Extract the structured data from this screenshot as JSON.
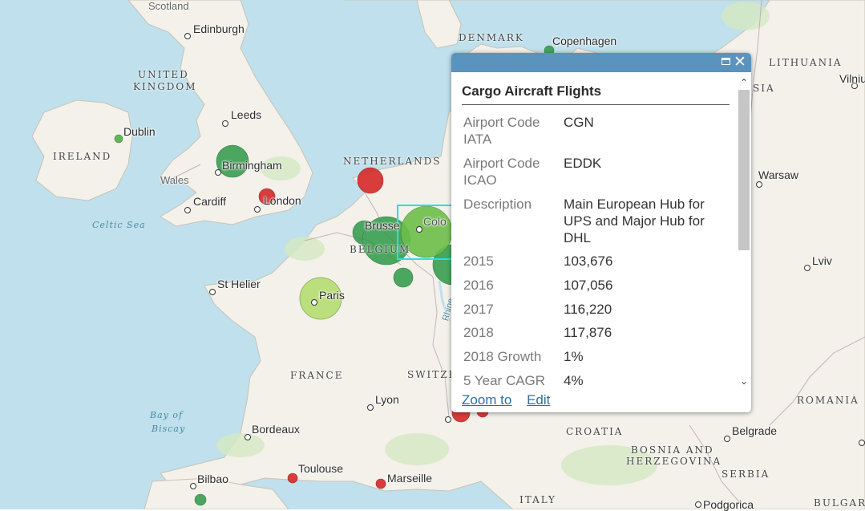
{
  "map": {
    "country_labels": [
      {
        "name": "denmark",
        "text": "DENMARK"
      },
      {
        "name": "united-kingdom-1",
        "text": "UNITED"
      },
      {
        "name": "united-kingdom-2",
        "text": "KINGDOM"
      },
      {
        "name": "ireland",
        "text": "IRELAND"
      },
      {
        "name": "netherlands",
        "text": "NETHERLANDS"
      },
      {
        "name": "belgium",
        "text": "BELGIUM"
      },
      {
        "name": "france",
        "text": "FRANCE"
      },
      {
        "name": "switzerland",
        "text": "SWITZE"
      },
      {
        "name": "lithuania",
        "text": "LITHUANIA"
      },
      {
        "name": "croatia",
        "text": "CROATIA"
      },
      {
        "name": "bosnia-1",
        "text": "BOSNIA AND"
      },
      {
        "name": "bosnia-2",
        "text": "HERZEGOVINA"
      },
      {
        "name": "serbia",
        "text": "SERBIA"
      },
      {
        "name": "romania",
        "text": "ROMANIA"
      },
      {
        "name": "italy",
        "text": "ITALY"
      },
      {
        "name": "bulgaria",
        "text": "BULGAR"
      },
      {
        "name": "scotland",
        "text": "Scotland"
      },
      {
        "name": "wales",
        "text": "Wales"
      },
      {
        "name": "sia",
        "text": "SIA"
      }
    ],
    "sea_labels": [
      {
        "name": "celtic-sea",
        "text": "Celtic Sea"
      },
      {
        "name": "bay-of-biscay-1",
        "text": "Bay of"
      },
      {
        "name": "bay-of-biscay-2",
        "text": "Biscay"
      }
    ],
    "cities": [
      {
        "name": "edinburgh",
        "text": "Edinburgh"
      },
      {
        "name": "leeds",
        "text": "Leeds"
      },
      {
        "name": "dublin",
        "text": "Dublin"
      },
      {
        "name": "birmingham",
        "text": "Birmingham"
      },
      {
        "name": "cardiff",
        "text": "Cardiff"
      },
      {
        "name": "london",
        "text": "London"
      },
      {
        "name": "copenhagen",
        "text": "Copenhagen"
      },
      {
        "name": "brussels",
        "text": "Brusse"
      },
      {
        "name": "cologne",
        "text": "Colo"
      },
      {
        "name": "st-helier",
        "text": "St Helier"
      },
      {
        "name": "paris",
        "text": "Paris"
      },
      {
        "name": "lyon",
        "text": "Lyon"
      },
      {
        "name": "bordeaux",
        "text": "Bordeaux"
      },
      {
        "name": "toulouse",
        "text": "Toulouse"
      },
      {
        "name": "bilbao",
        "text": "Bilbao"
      },
      {
        "name": "marseille",
        "text": "Marseille"
      },
      {
        "name": "vilnius",
        "text": "Vilniu"
      },
      {
        "name": "warsaw",
        "text": "Warsaw"
      },
      {
        "name": "lviv",
        "text": "Lviv"
      },
      {
        "name": "belgrade",
        "text": "Belgrade"
      },
      {
        "name": "podgorica",
        "text": "Podgorica"
      },
      {
        "name": "rhine",
        "text": "Rhine"
      }
    ],
    "marker_colors": {
      "high": "#2e9a47",
      "mid": "#6cbf4a",
      "light": "#b9df77",
      "low": "#d62d2d"
    }
  },
  "popup": {
    "title": "Cargo Aircraft Flights",
    "fields": [
      {
        "label": "Airport Code IATA",
        "value": "CGN"
      },
      {
        "label": "Airport Code ICAO",
        "value": "EDDK"
      },
      {
        "label": "Description",
        "value": "Main European Hub for UPS and Major Hub for DHL"
      },
      {
        "label": "2015",
        "value": "103,676"
      },
      {
        "label": "2016",
        "value": "107,056"
      },
      {
        "label": "2017",
        "value": "116,220"
      },
      {
        "label": "2018",
        "value": "117,876"
      },
      {
        "label": "2018 Growth",
        "value": "1%"
      },
      {
        "label": "5 Year CAGR",
        "value": "4%"
      }
    ],
    "actions": {
      "zoom_to": "Zoom to",
      "edit": "Edit"
    },
    "icons": {
      "maximize": "maximize-icon",
      "close": "close-icon",
      "scroll_up": "chevron-up-icon",
      "scroll_down": "chevron-down-icon"
    }
  }
}
